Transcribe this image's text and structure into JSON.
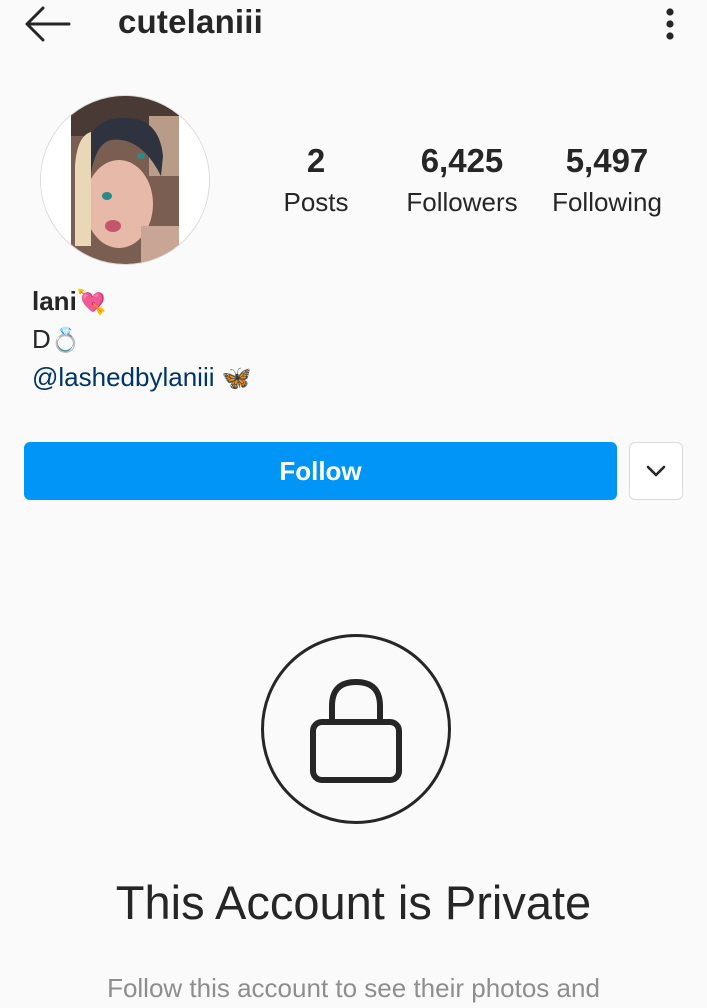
{
  "header": {
    "username": "cutelaniii",
    "back_icon": "arrow-left-icon",
    "more_icon": "more-vertical-icon"
  },
  "profile": {
    "avatar_icon": "profile-photo",
    "stats": {
      "posts_value": "2",
      "posts_label": "Posts",
      "followers_value": "6,425",
      "followers_label": "Followers",
      "following_value": "5,497",
      "following_label": "Following"
    },
    "bio": {
      "name": "lani",
      "name_emoji": "💘",
      "line2": "D",
      "line2_emoji": "💍",
      "link": "@lashedbylaniii",
      "link_emoji": "🦋"
    }
  },
  "actions": {
    "follow_label": "Follow",
    "follow_color": "#0095f6",
    "dropdown_icon": "chevron-down-icon"
  },
  "private": {
    "lock_icon": "lock-icon",
    "title": "This Account is Private",
    "subtitle": "Follow this account to see their photos and"
  }
}
